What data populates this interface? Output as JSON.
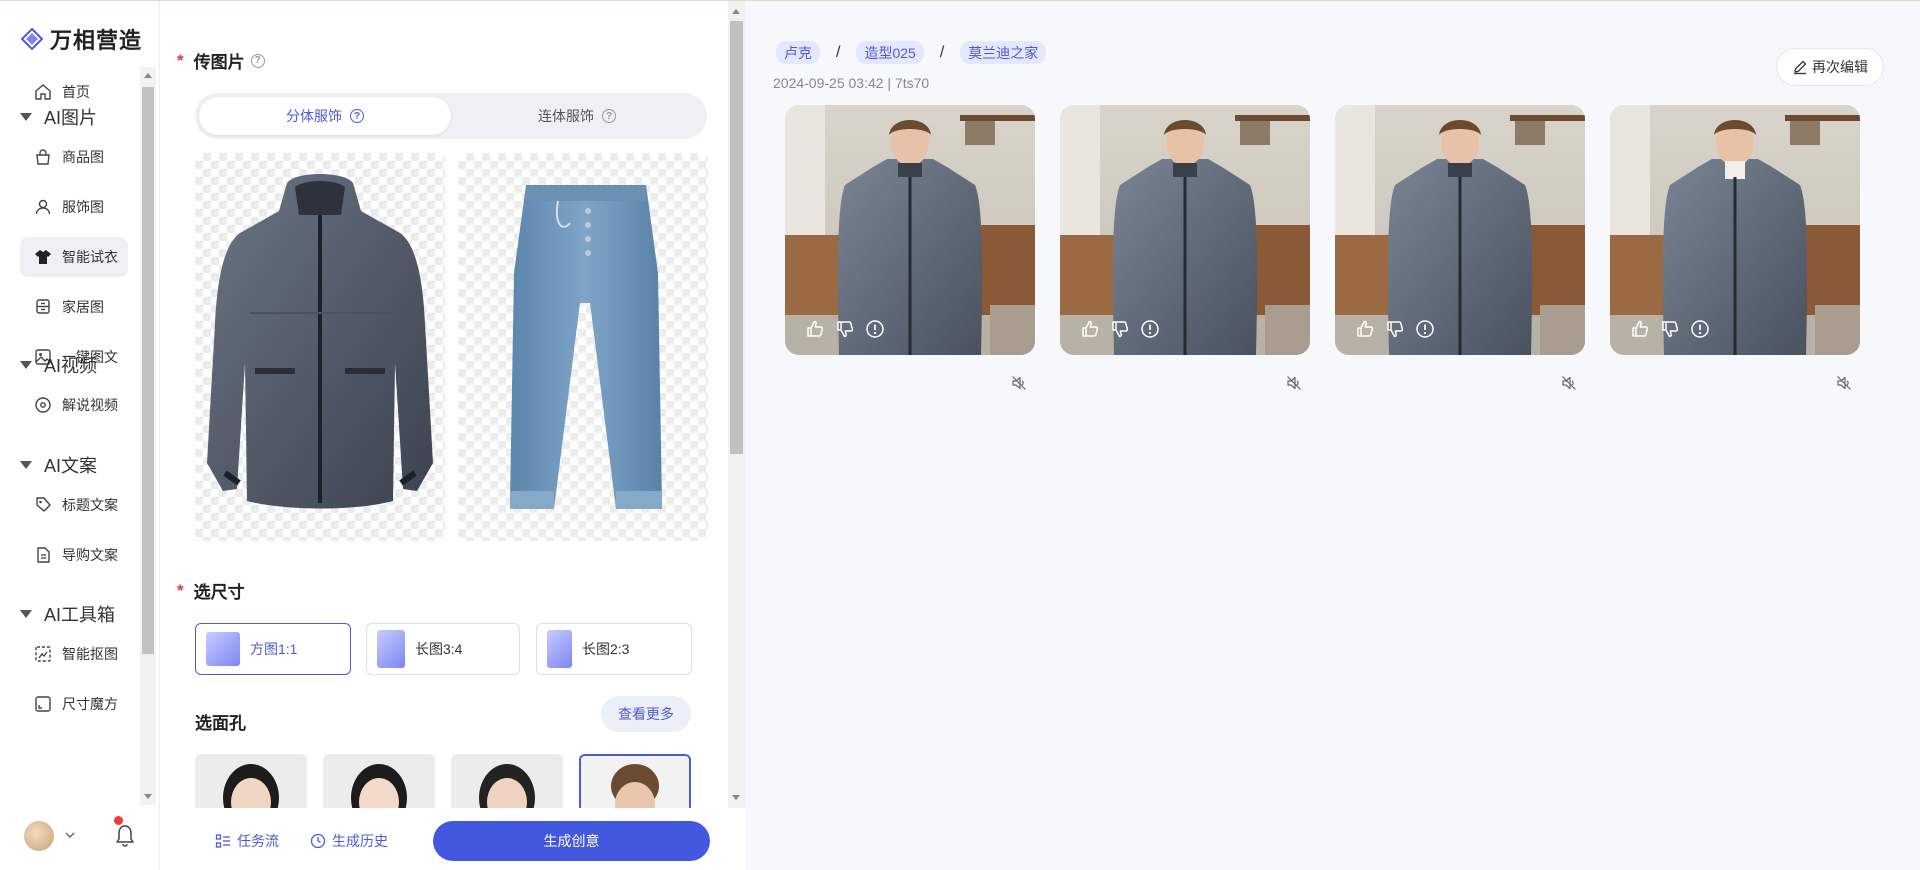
{
  "app": {
    "name": "万相营造"
  },
  "sidebar": {
    "items": [
      {
        "type": "item",
        "label": "首页",
        "icon": "home-icon"
      },
      {
        "type": "group",
        "label": "AI图片"
      },
      {
        "type": "item",
        "label": "商品图",
        "icon": "bag-icon"
      },
      {
        "type": "item",
        "label": "服饰图",
        "icon": "user-icon"
      },
      {
        "type": "item",
        "label": "智能试衣",
        "icon": "shirt-icon",
        "active": true
      },
      {
        "type": "item",
        "label": "家居图",
        "icon": "cabinet-icon"
      },
      {
        "type": "item",
        "label": "一键图文",
        "icon": "image-icon"
      },
      {
        "type": "group",
        "label": "AI视频"
      },
      {
        "type": "item",
        "label": "解说视频",
        "icon": "disc-icon"
      },
      {
        "type": "group",
        "label": "AI文案"
      },
      {
        "type": "item",
        "label": "标题文案",
        "icon": "tag-icon"
      },
      {
        "type": "item",
        "label": "导购文案",
        "icon": "document-icon"
      },
      {
        "type": "group",
        "label": "AI工具箱"
      },
      {
        "type": "item",
        "label": "智能抠图",
        "icon": "cutout-icon"
      },
      {
        "type": "item",
        "label": "尺寸魔方",
        "icon": "resize-icon"
      }
    ]
  },
  "panel": {
    "upload_title": "传图片",
    "segment": {
      "options": [
        "分体服饰",
        "连体服饰"
      ],
      "selected": "分体服饰"
    },
    "size_title": "选尺寸",
    "sizes": [
      {
        "label": "方图1:1",
        "selected": true
      },
      {
        "label": "长图3:4",
        "selected": false
      },
      {
        "label": "长图2:3",
        "selected": false
      }
    ],
    "face_title": "选面孔",
    "more_label": "查看更多",
    "bottom": {
      "task_flow": "任务流",
      "history": "生成历史",
      "generate": "生成创意"
    }
  },
  "result": {
    "tags": [
      "卢克",
      "造型025",
      "莫兰迪之家"
    ],
    "separator": "/",
    "meta": "2024-09-25 03:42 | 7ts70",
    "edit_label": "再次编辑"
  },
  "colors": {
    "accent": "#4357df",
    "tag_bg": "#e4e8fa",
    "required": "#e4393c"
  }
}
